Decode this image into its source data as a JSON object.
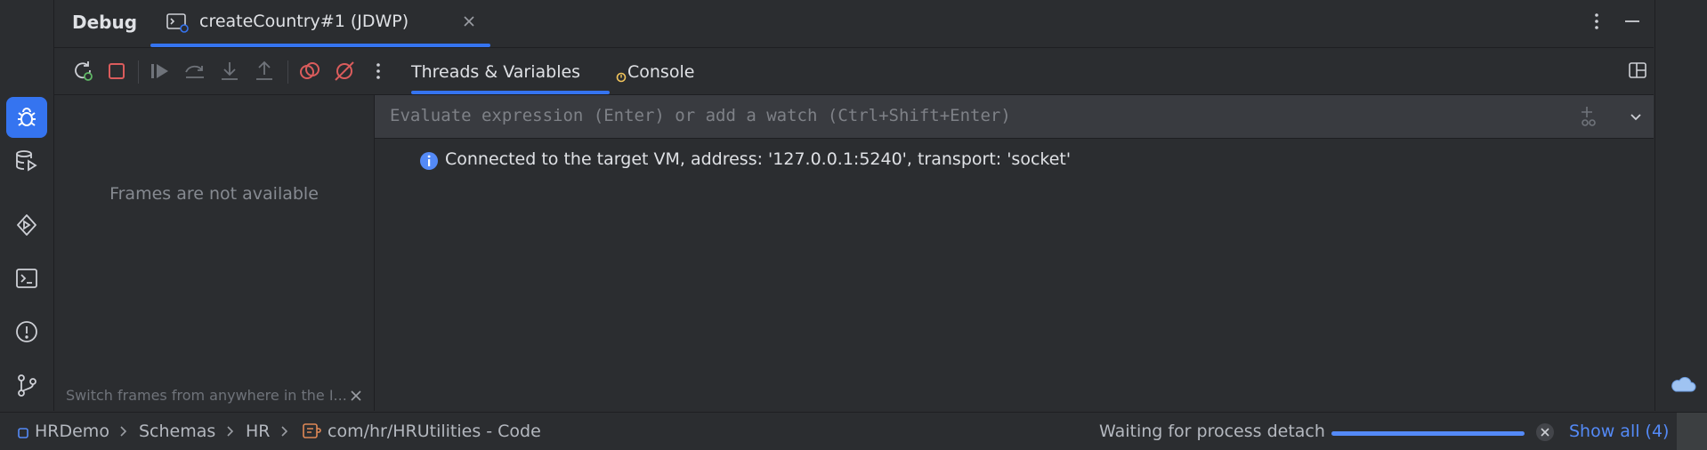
{
  "header": {
    "title": "Debug",
    "tab_label": "createCountry#1 (JDWP)"
  },
  "toolbar": {
    "tabs": [
      {
        "label": "Threads & Variables",
        "active": true
      },
      {
        "label": "Console",
        "active": false
      }
    ]
  },
  "frames": {
    "empty_text": "Frames are not available",
    "hint": "Switch frames from anywhere in the I..."
  },
  "evaluate": {
    "placeholder": "Evaluate expression (Enter) or add a watch (Ctrl+Shift+Enter)"
  },
  "console": {
    "message": "Connected to the target VM, address: '127.0.0.1:5240', transport: 'socket'"
  },
  "statusbar": {
    "breadcrumbs": [
      "HRDemo",
      "Schemas",
      "HR",
      "com/hr/HRUtilities - Code"
    ],
    "status_text": "Waiting for process detach",
    "progress_percent": 100,
    "show_all_label": "Show all (4)"
  },
  "colors": {
    "accent": "#3574f0",
    "background": "#2b2d30",
    "stop_red": "#db5c5c",
    "link_blue": "#548af7"
  }
}
